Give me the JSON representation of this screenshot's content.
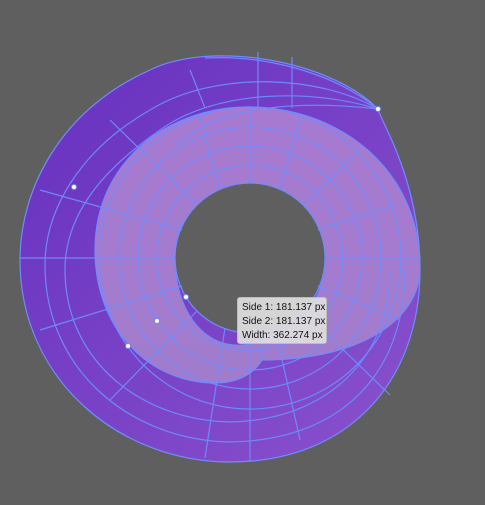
{
  "canvas": {
    "background": "#5f5f5f",
    "outer_fill": "#7a48c8",
    "inner_fill": "#a878c8",
    "mesh_color": "#6f8cff",
    "anchor_color": "#ffffff"
  },
  "measure_tooltip": {
    "side1": "Side 1: 181.137 px",
    "side2": "Side 2: 181.137 px",
    "width": "Width:  362.274 px"
  }
}
